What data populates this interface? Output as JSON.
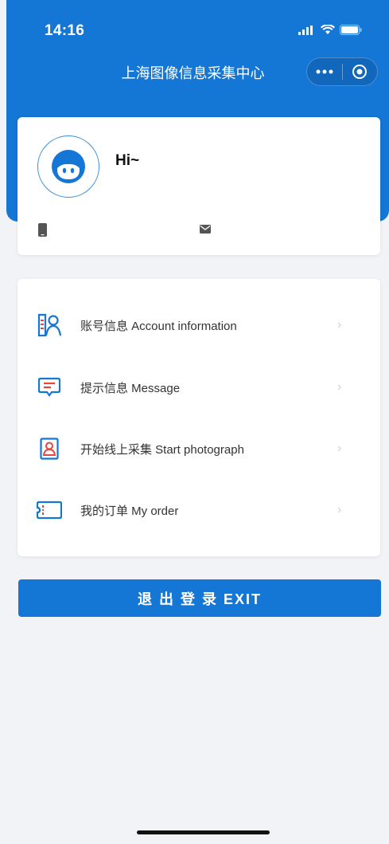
{
  "status_bar": {
    "time": "14:16"
  },
  "nav": {
    "title": "上海图像信息采集中心"
  },
  "profile": {
    "greeting": "Hi~"
  },
  "menu": {
    "items": [
      {
        "label": "账号信息 Account information",
        "icon": "account-icon"
      },
      {
        "label": "提示信息 Message",
        "icon": "message-icon"
      },
      {
        "label": "开始线上采集 Start photograph",
        "icon": "photograph-icon"
      },
      {
        "label": "我的订单 My order",
        "icon": "order-icon"
      }
    ],
    "chevron": "›"
  },
  "exit_button": {
    "label": "退 出 登 录 EXIT"
  },
  "colors": {
    "primary": "#1476d5",
    "accent_red": "#e8453c",
    "background": "#f2f3f7"
  }
}
